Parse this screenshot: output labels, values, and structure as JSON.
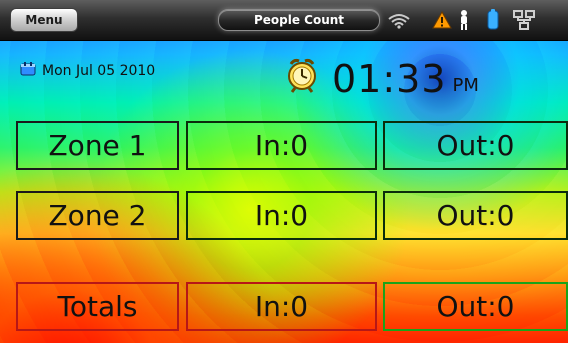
{
  "topbar": {
    "menu_label": "Menu",
    "title": "People Count",
    "tray_icons": [
      "wifi-icon",
      "warning-icon",
      "person-icon",
      "battery-icon",
      "network-icon"
    ]
  },
  "status": {
    "date": "Mon Jul 05 2010",
    "date_icon": "calendar-icon",
    "clock_icon": "alarm-clock-icon",
    "time": "01:33",
    "ampm": "PM"
  },
  "rows": [
    {
      "label": "Zone 1",
      "in": "In:0",
      "out": "Out:0"
    },
    {
      "label": "Zone 2",
      "in": "In:0",
      "out": "Out:0"
    },
    {
      "label": "Totals",
      "in": "In:0",
      "out": "Out:0"
    }
  ],
  "colors": {
    "accent_warning": "#ff9a00",
    "accent_blue": "#3ab0ff",
    "totals_border_red": "#b71717",
    "totals_border_green": "#1aa31a"
  }
}
